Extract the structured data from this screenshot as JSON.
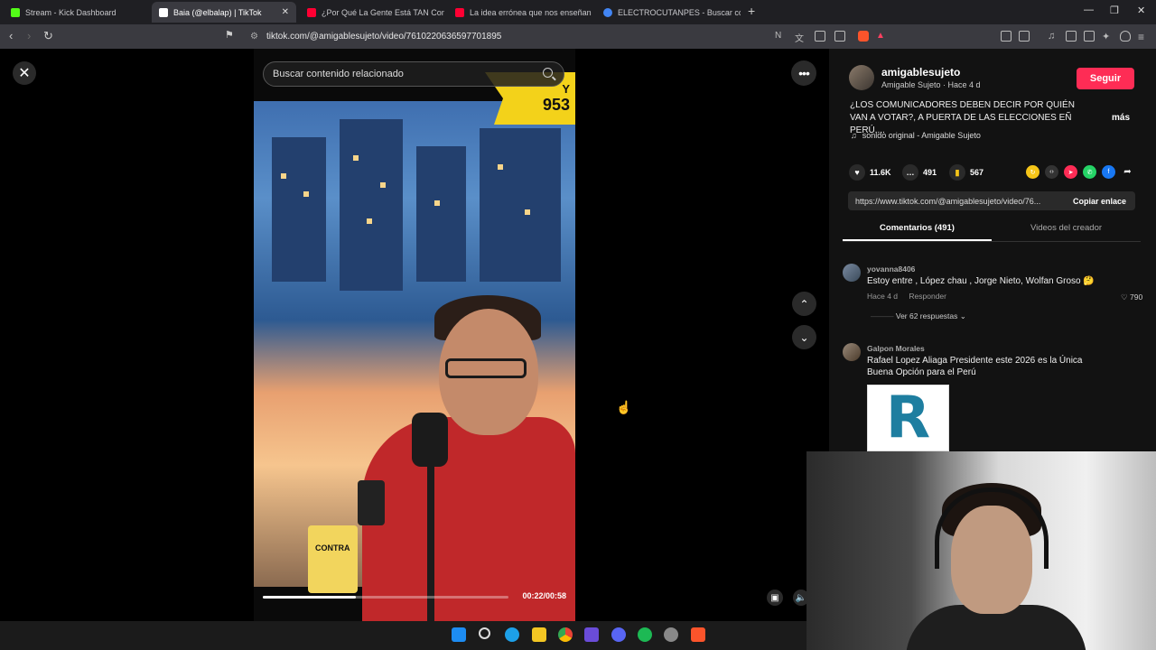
{
  "browser": {
    "tabs": [
      {
        "label": "Stream - Kick Dashboard",
        "color": "#53fc18"
      },
      {
        "label": "Baia (@elbalap) | TikTok",
        "color": "#ffffff"
      },
      {
        "label": "¿Por Qué La Gente Está TAN Confiad",
        "color": "#ff0033"
      },
      {
        "label": "La idea errónea que nos enseñan sob",
        "color": "#ff0033"
      },
      {
        "label": "ELECTROCUTANPES - Buscar con Goo",
        "color": "#4285f4"
      }
    ],
    "url": "tiktok.com/@amigablesujeto/video/7610220636597701895"
  },
  "video": {
    "search_placeholder": "Buscar contenido relacionado",
    "banner_letter": "Y",
    "banner_number": "953",
    "mug_text": "CONTRA",
    "timecode": "00:22/00:58",
    "progress": 0.379
  },
  "post": {
    "username": "amigablesujeto",
    "subline": "Amigable Sujeto · Hace 4 d",
    "follow_label": "Seguir",
    "description": "¿LOS COMUNICADORES DEBEN DECIR POR QUIÉN VAN A VOTAR?, A PUERTA DE LAS ELECCIONES EÑ PERÚ,...",
    "more_label": "más",
    "sound": "sonido original - Amigable Sujeto",
    "likes": "11.6K",
    "comments": "491",
    "saves": "567",
    "link": "https://www.tiktok.com/@amigablesujeto/video/76...",
    "copy_label": "Copiar enlace",
    "tab_comments": "Comentarios (491)",
    "tab_videos": "Videos del creador"
  },
  "comments": [
    {
      "user": "yovanna8406",
      "text": "Estoy entre , López chau , Jorge Nieto, Wolfan Groso 🤔",
      "time": "Hace 4 d",
      "reply": "Responder",
      "likes": "790",
      "replies": "Ver 62 respuestas"
    },
    {
      "user": "Galpon Morales",
      "text": "Rafael Lopez Aliaga Presidente este 2026 es la Única Buena Opción para el Perú",
      "image_letter": "R"
    }
  ]
}
